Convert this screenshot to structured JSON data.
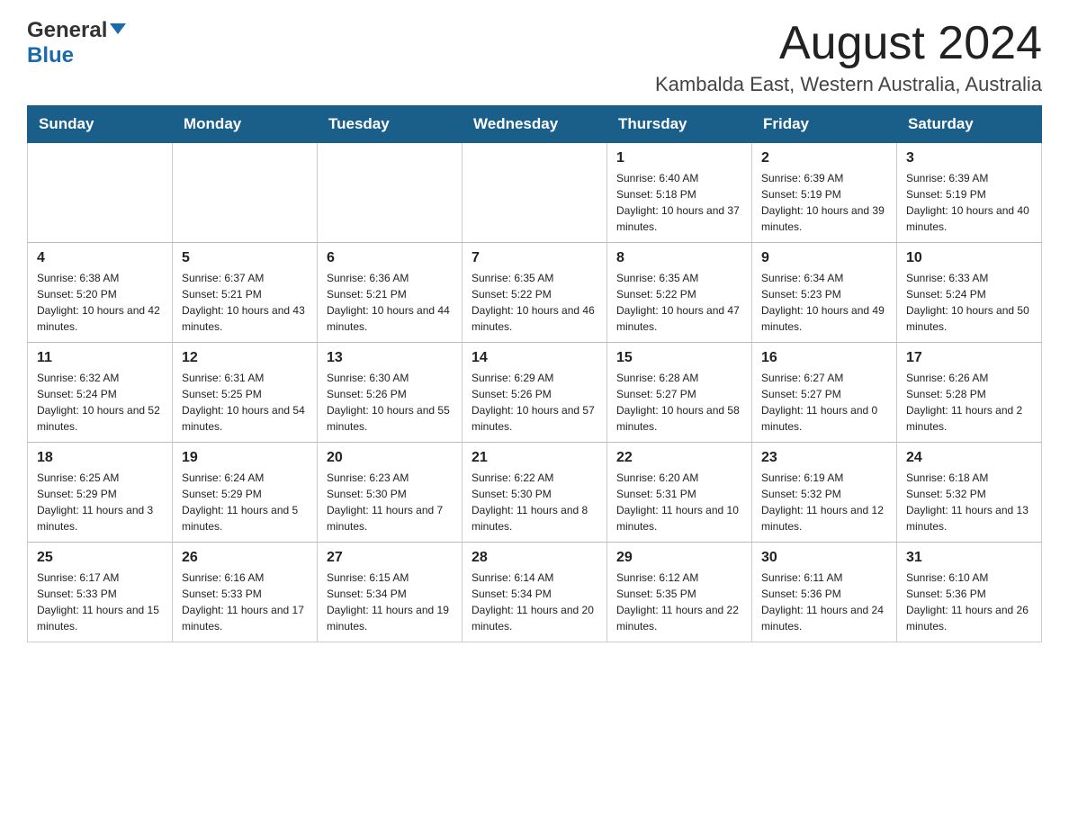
{
  "header": {
    "logo_general": "General",
    "logo_blue": "Blue",
    "month_title": "August 2024",
    "location": "Kambalda East, Western Australia, Australia"
  },
  "calendar": {
    "days": [
      "Sunday",
      "Monday",
      "Tuesday",
      "Wednesday",
      "Thursday",
      "Friday",
      "Saturday"
    ],
    "weeks": [
      [
        {
          "date": "",
          "info": ""
        },
        {
          "date": "",
          "info": ""
        },
        {
          "date": "",
          "info": ""
        },
        {
          "date": "",
          "info": ""
        },
        {
          "date": "1",
          "info": "Sunrise: 6:40 AM\nSunset: 5:18 PM\nDaylight: 10 hours and 37 minutes."
        },
        {
          "date": "2",
          "info": "Sunrise: 6:39 AM\nSunset: 5:19 PM\nDaylight: 10 hours and 39 minutes."
        },
        {
          "date": "3",
          "info": "Sunrise: 6:39 AM\nSunset: 5:19 PM\nDaylight: 10 hours and 40 minutes."
        }
      ],
      [
        {
          "date": "4",
          "info": "Sunrise: 6:38 AM\nSunset: 5:20 PM\nDaylight: 10 hours and 42 minutes."
        },
        {
          "date": "5",
          "info": "Sunrise: 6:37 AM\nSunset: 5:21 PM\nDaylight: 10 hours and 43 minutes."
        },
        {
          "date": "6",
          "info": "Sunrise: 6:36 AM\nSunset: 5:21 PM\nDaylight: 10 hours and 44 minutes."
        },
        {
          "date": "7",
          "info": "Sunrise: 6:35 AM\nSunset: 5:22 PM\nDaylight: 10 hours and 46 minutes."
        },
        {
          "date": "8",
          "info": "Sunrise: 6:35 AM\nSunset: 5:22 PM\nDaylight: 10 hours and 47 minutes."
        },
        {
          "date": "9",
          "info": "Sunrise: 6:34 AM\nSunset: 5:23 PM\nDaylight: 10 hours and 49 minutes."
        },
        {
          "date": "10",
          "info": "Sunrise: 6:33 AM\nSunset: 5:24 PM\nDaylight: 10 hours and 50 minutes."
        }
      ],
      [
        {
          "date": "11",
          "info": "Sunrise: 6:32 AM\nSunset: 5:24 PM\nDaylight: 10 hours and 52 minutes."
        },
        {
          "date": "12",
          "info": "Sunrise: 6:31 AM\nSunset: 5:25 PM\nDaylight: 10 hours and 54 minutes."
        },
        {
          "date": "13",
          "info": "Sunrise: 6:30 AM\nSunset: 5:26 PM\nDaylight: 10 hours and 55 minutes."
        },
        {
          "date": "14",
          "info": "Sunrise: 6:29 AM\nSunset: 5:26 PM\nDaylight: 10 hours and 57 minutes."
        },
        {
          "date": "15",
          "info": "Sunrise: 6:28 AM\nSunset: 5:27 PM\nDaylight: 10 hours and 58 minutes."
        },
        {
          "date": "16",
          "info": "Sunrise: 6:27 AM\nSunset: 5:27 PM\nDaylight: 11 hours and 0 minutes."
        },
        {
          "date": "17",
          "info": "Sunrise: 6:26 AM\nSunset: 5:28 PM\nDaylight: 11 hours and 2 minutes."
        }
      ],
      [
        {
          "date": "18",
          "info": "Sunrise: 6:25 AM\nSunset: 5:29 PM\nDaylight: 11 hours and 3 minutes."
        },
        {
          "date": "19",
          "info": "Sunrise: 6:24 AM\nSunset: 5:29 PM\nDaylight: 11 hours and 5 minutes."
        },
        {
          "date": "20",
          "info": "Sunrise: 6:23 AM\nSunset: 5:30 PM\nDaylight: 11 hours and 7 minutes."
        },
        {
          "date": "21",
          "info": "Sunrise: 6:22 AM\nSunset: 5:30 PM\nDaylight: 11 hours and 8 minutes."
        },
        {
          "date": "22",
          "info": "Sunrise: 6:20 AM\nSunset: 5:31 PM\nDaylight: 11 hours and 10 minutes."
        },
        {
          "date": "23",
          "info": "Sunrise: 6:19 AM\nSunset: 5:32 PM\nDaylight: 11 hours and 12 minutes."
        },
        {
          "date": "24",
          "info": "Sunrise: 6:18 AM\nSunset: 5:32 PM\nDaylight: 11 hours and 13 minutes."
        }
      ],
      [
        {
          "date": "25",
          "info": "Sunrise: 6:17 AM\nSunset: 5:33 PM\nDaylight: 11 hours and 15 minutes."
        },
        {
          "date": "26",
          "info": "Sunrise: 6:16 AM\nSunset: 5:33 PM\nDaylight: 11 hours and 17 minutes."
        },
        {
          "date": "27",
          "info": "Sunrise: 6:15 AM\nSunset: 5:34 PM\nDaylight: 11 hours and 19 minutes."
        },
        {
          "date": "28",
          "info": "Sunrise: 6:14 AM\nSunset: 5:34 PM\nDaylight: 11 hours and 20 minutes."
        },
        {
          "date": "29",
          "info": "Sunrise: 6:12 AM\nSunset: 5:35 PM\nDaylight: 11 hours and 22 minutes."
        },
        {
          "date": "30",
          "info": "Sunrise: 6:11 AM\nSunset: 5:36 PM\nDaylight: 11 hours and 24 minutes."
        },
        {
          "date": "31",
          "info": "Sunrise: 6:10 AM\nSunset: 5:36 PM\nDaylight: 11 hours and 26 minutes."
        }
      ]
    ]
  }
}
